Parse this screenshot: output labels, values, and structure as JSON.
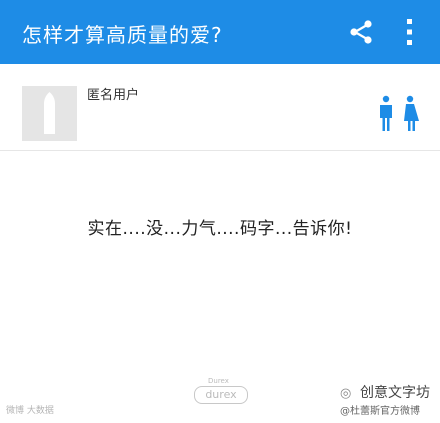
{
  "header": {
    "title": "怎样才算高质量的爱?",
    "share_icon": "share-icon",
    "more_icon": "more-vertical-icon",
    "background": "#1e8ce6"
  },
  "user": {
    "name": "匿名用户",
    "avatar_icon": "avatar-placeholder",
    "gender_icon": "male-female-icon"
  },
  "content": {
    "text": "实在....没...力气....码字...告诉你!"
  },
  "watermarks": {
    "left": "微博 大数据",
    "brand_small": "Durex",
    "brand": "durex",
    "right_title": "创意文字坊",
    "right_sub": "@杜蕾斯官方微博"
  }
}
